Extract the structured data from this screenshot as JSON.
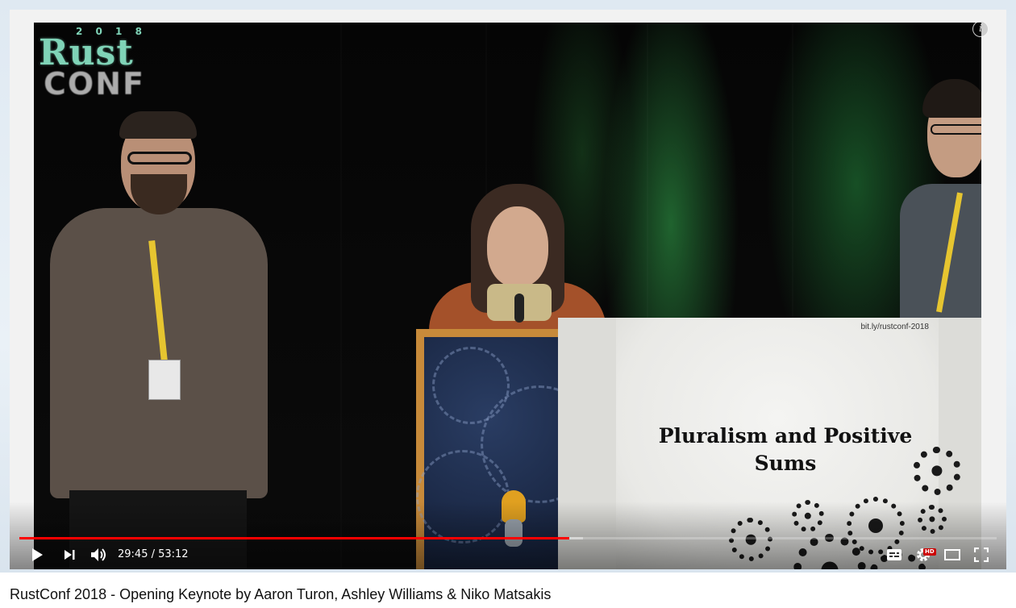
{
  "player": {
    "logo": {
      "year": "2 0 1 8",
      "word1": "Rust",
      "word2": "CONF"
    },
    "info_icon": "info-icon",
    "slide": {
      "url": "bit.ly/rustconf-2018",
      "title_line1": "Pluralism and Positive",
      "title_line2": "Sums"
    },
    "controls": {
      "current_time": "29:45",
      "duration": "53:12",
      "time_text": "29:45 / 53:12",
      "played_fraction": 0.563,
      "buffered_fraction": 0.577,
      "hd_badge": "HD",
      "icons": [
        "play-icon",
        "next-icon",
        "volume-icon",
        "subtitles-icon",
        "settings-icon",
        "theater-mode-icon",
        "fullscreen-icon"
      ]
    },
    "colors": {
      "progress_played": "#ff0000",
      "hd_badge": "#cc0000"
    }
  },
  "video_title": "RustConf 2018 - Opening Keynote by Aaron Turon, Ashley Williams & Niko Matsakis"
}
